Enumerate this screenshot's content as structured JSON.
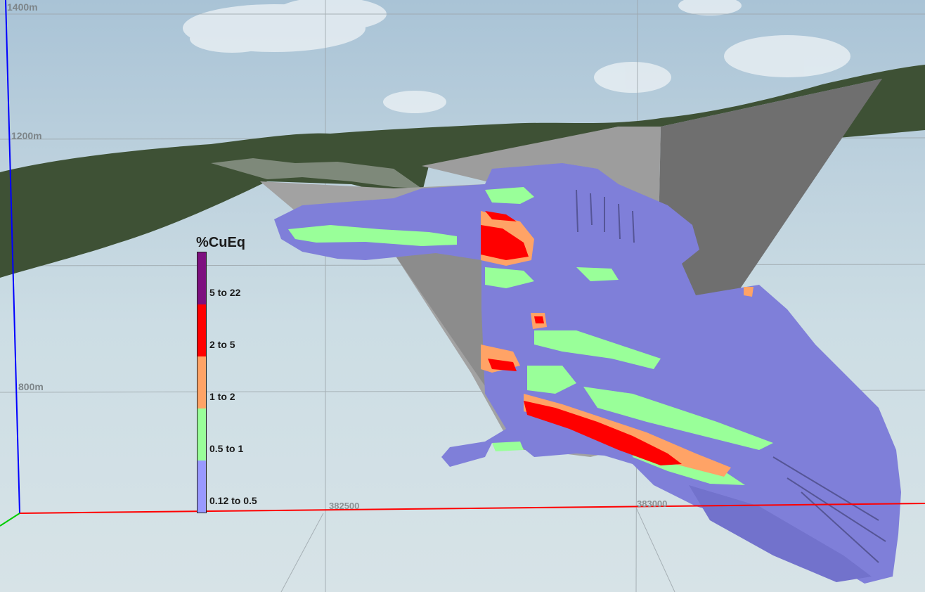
{
  "elevation_labels": [
    "1400m",
    "1200m",
    "800m"
  ],
  "easting_labels": [
    "382500",
    "383000"
  ],
  "legend": {
    "title": "%CuEq",
    "classes": [
      {
        "label": "5 to 22",
        "color": "#7d0f7f"
      },
      {
        "label": "2 to 5",
        "color": "#ff0000"
      },
      {
        "label": "1 to 2",
        "color": "#ffa366"
      },
      {
        "label": "0.5 to 1",
        "color": "#99ff99"
      },
      {
        "label": "0.12 to 0.5",
        "color": "#9999ff"
      }
    ]
  },
  "colors": {
    "block_low": "#7f7fd9",
    "block_mid": "#99ff99",
    "block_high": "#ffa366",
    "block_vhigh": "#ff0000",
    "pit_wall": "#7e7e7e",
    "terrain": "#3f5238",
    "x_axis": "#ff0000",
    "z_axis": "#0000ff",
    "y_axis": "#00cc00"
  }
}
